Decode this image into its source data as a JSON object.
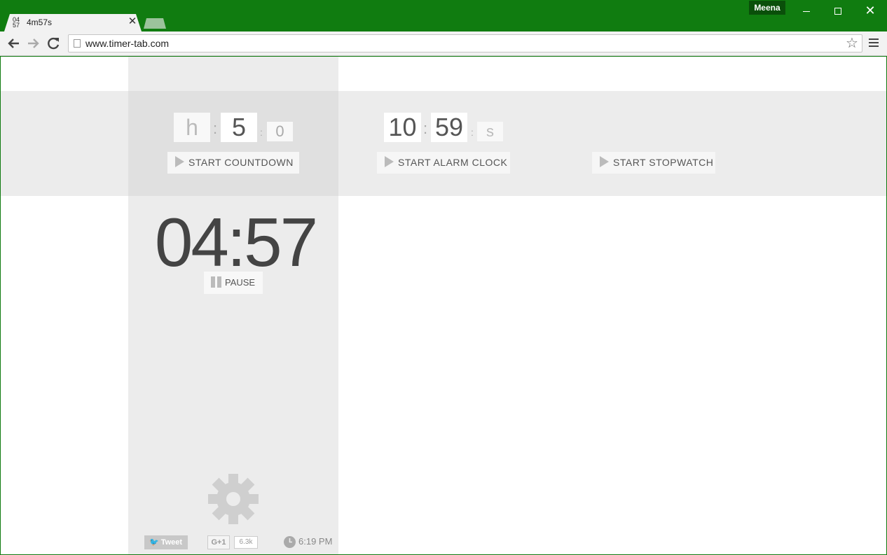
{
  "browser": {
    "tab_title": "4m57s",
    "tab_favicon_top": "04",
    "tab_favicon_bottom": "57",
    "profile_name": "Meena",
    "url": "www.timer-tab.com"
  },
  "countdown": {
    "hours_placeholder": "h",
    "minutes_value": "5",
    "seconds_value": "0",
    "start_label": "START  COUNTDOWN",
    "remaining": "04:57",
    "pause_label": "PAUSE"
  },
  "alarm": {
    "hours_value": "10",
    "minutes_value": "59",
    "seconds_placeholder": "s",
    "start_label": "START  ALARM CLOCK"
  },
  "stopwatch": {
    "start_label": "START  STOPWATCH"
  },
  "footer": {
    "tweet_label": "Tweet",
    "gplus_label": "G+1",
    "gplus_count": "6.3k",
    "clock_time": "6:19 PM"
  },
  "icons": {
    "back": "arrow-left-icon",
    "forward": "arrow-right-icon",
    "reload": "reload-icon",
    "star": "star-icon",
    "menu": "hamburger-menu-icon",
    "settings": "gear-icon",
    "play": "play-icon",
    "pause": "pause-icon",
    "clock": "clock-icon"
  },
  "colors": {
    "titlebar": "#107c10",
    "panel": "#ececec",
    "text_dark": "#444444"
  }
}
